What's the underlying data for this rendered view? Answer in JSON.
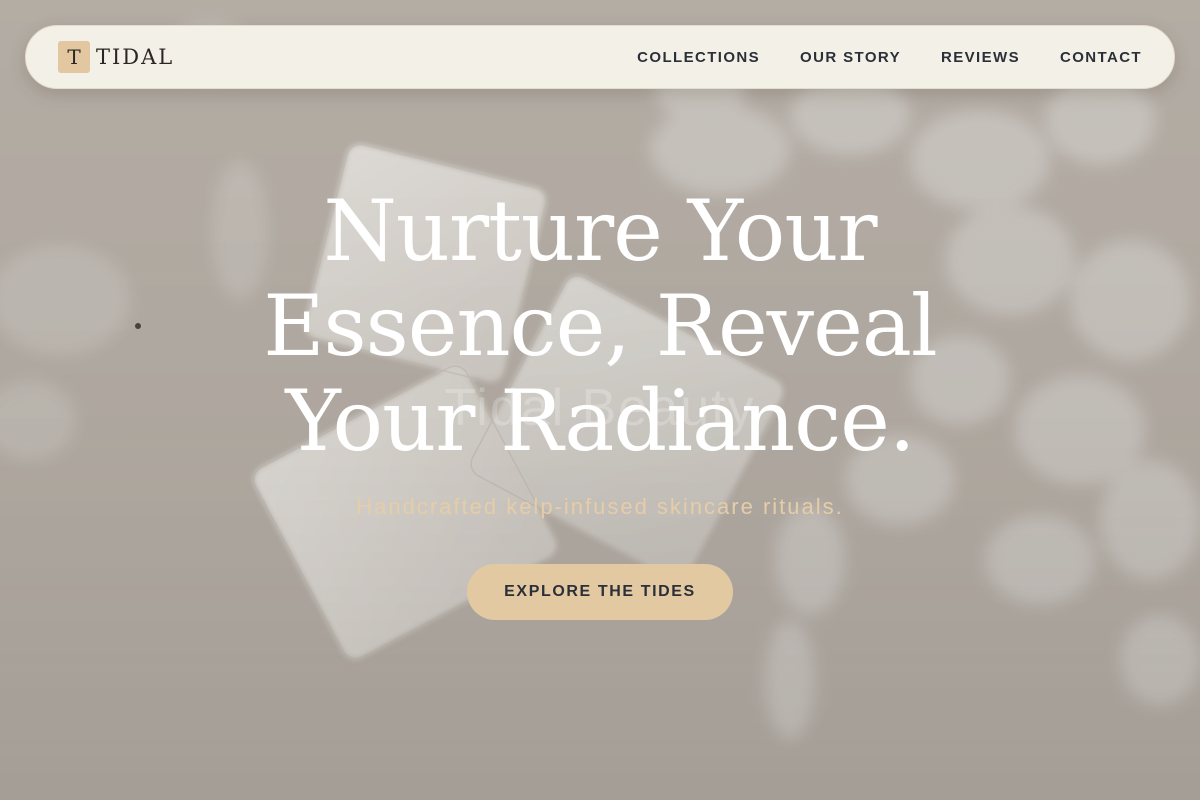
{
  "brand": {
    "logo_letter": "T",
    "name": "TIDAL"
  },
  "nav": {
    "links": [
      {
        "label": "COLLECTIONS"
      },
      {
        "label": "OUR STORY"
      },
      {
        "label": "REVIEWS"
      },
      {
        "label": "CONTACT"
      }
    ]
  },
  "hero": {
    "headline_lines": [
      "Nurture Your",
      "Essence, Reveal",
      "Your Radiance."
    ],
    "background_text": "Tidal Beauty",
    "subtitle": "Handcrafted kelp-infused skincare rituals.",
    "cta_label": "EXPLORE THE TIDES"
  },
  "colors": {
    "accent": "#e3c9a2",
    "nav_bg": "#f3f0e8",
    "text_dark": "#2b2f38",
    "subtitle": "#e6cda8"
  }
}
